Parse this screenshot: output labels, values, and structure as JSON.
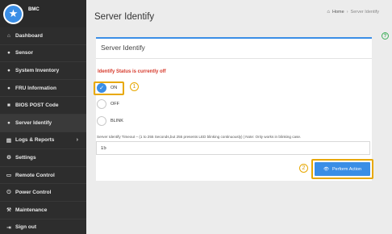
{
  "brand": {
    "name": "BMC",
    "logo_icon": "star-icon"
  },
  "sidebar": {
    "items": [
      {
        "label": "Dashboard",
        "icon": "⌂",
        "active": false
      },
      {
        "label": "Sensor",
        "icon": "●",
        "active": false
      },
      {
        "label": "System Inventory",
        "icon": "●",
        "active": false
      },
      {
        "label": "FRU Information",
        "icon": "●",
        "active": false
      },
      {
        "label": "BIOS POST Code",
        "icon": "■",
        "active": false
      },
      {
        "label": "Server Identify",
        "icon": "●",
        "active": true
      },
      {
        "label": "Logs & Reports",
        "icon": "▤",
        "active": false,
        "chevron": "›"
      },
      {
        "label": "Settings",
        "icon": "⚙",
        "active": false
      },
      {
        "label": "Remote Control",
        "icon": "▭",
        "active": false
      },
      {
        "label": "Power Control",
        "icon": "⏻",
        "active": false
      },
      {
        "label": "Maintenance",
        "icon": "⚒",
        "active": false
      },
      {
        "label": "Sign out",
        "icon": "⇥",
        "active": false
      }
    ]
  },
  "header": {
    "title": "Server Identify",
    "breadcrumb": {
      "home": "Home",
      "separator": "›",
      "current": "Server Identify"
    }
  },
  "panel": {
    "title": "Server Identify",
    "status": "Identify Status is currently off",
    "options": [
      {
        "label": "ON",
        "checked": true
      },
      {
        "label": "OFF",
        "checked": false
      },
      {
        "label": "BLINK",
        "checked": false
      }
    ],
    "timeout_label": "Server Identify Timeout – (1 to 255 Seconds,but 255 presents LED blinking continuously) | Note: Only works in blinking case.",
    "timeout_value": "15",
    "action_label": "Perform Action"
  },
  "callouts": {
    "one": "1",
    "two": "2"
  },
  "colors": {
    "accent": "#3a8ee6",
    "highlight": "#e8a800",
    "status_red": "#d6392b",
    "sidebar_bg": "#2d2d2d"
  }
}
